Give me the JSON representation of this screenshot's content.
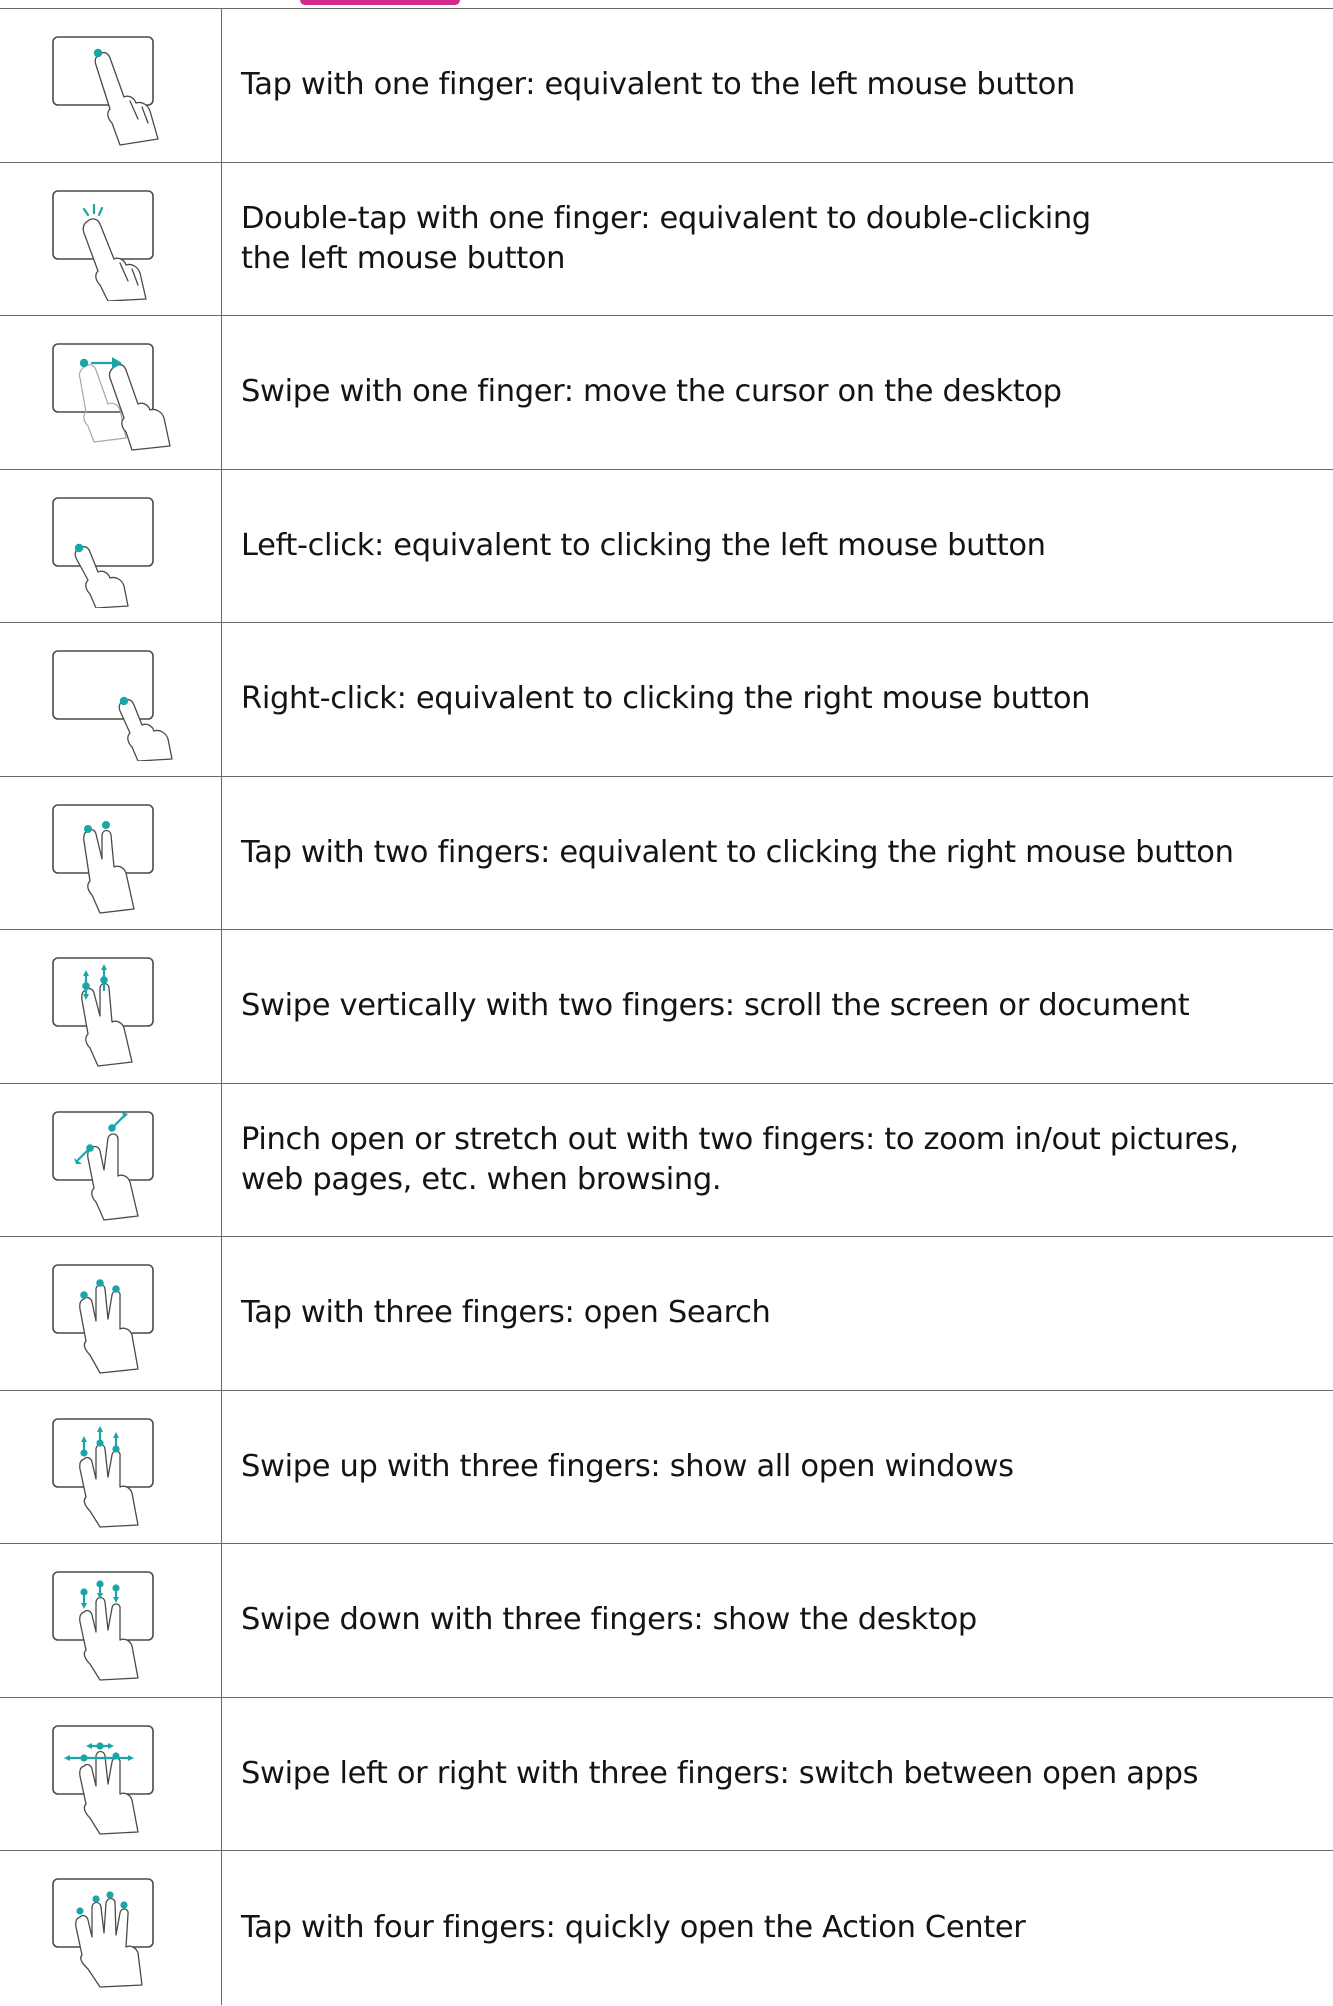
{
  "accent_color": "#1aa5a8",
  "gestures": [
    {
      "icon": "tap-one-finger-icon",
      "description": "Tap with one finger: equivalent to the left mouse button"
    },
    {
      "icon": "double-tap-one-finger-icon",
      "description": "Double-tap with one finger: equivalent to double-clicking\nthe left mouse button"
    },
    {
      "icon": "swipe-one-finger-icon",
      "description": "Swipe with one finger: move the cursor on the desktop"
    },
    {
      "icon": "left-click-icon",
      "description": "Left-click: equivalent to clicking the left mouse button"
    },
    {
      "icon": "right-click-icon",
      "description": "Right-click: equivalent to clicking the right mouse button"
    },
    {
      "icon": "tap-two-fingers-icon",
      "description": "Tap with two fingers: equivalent to clicking the right mouse button"
    },
    {
      "icon": "swipe-vertical-two-fingers-icon",
      "description": "Swipe vertically with two fingers: scroll the screen or document"
    },
    {
      "icon": "pinch-two-fingers-icon",
      "description": "Pinch open or stretch out with two fingers: to zoom in/out pictures,\nweb pages, etc. when browsing."
    },
    {
      "icon": "tap-three-fingers-icon",
      "description": "Tap with three fingers: open Search"
    },
    {
      "icon": "swipe-up-three-fingers-icon",
      "description": "Swipe up with three fingers: show all open windows"
    },
    {
      "icon": "swipe-down-three-fingers-icon",
      "description": "Swipe down with three fingers: show the desktop"
    },
    {
      "icon": "swipe-left-right-three-fingers-icon",
      "description": "Swipe left or right with three fingers: switch between open apps"
    },
    {
      "icon": "tap-four-fingers-icon",
      "description": "Tap with four fingers: quickly open the Action Center"
    }
  ]
}
